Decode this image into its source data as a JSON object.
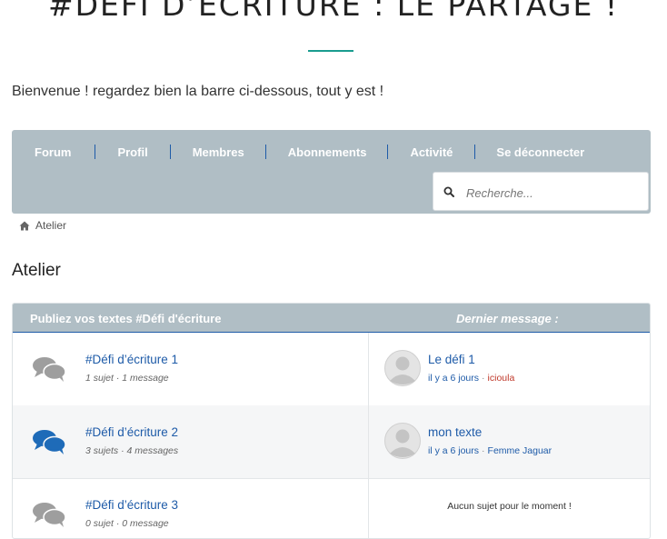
{
  "header": {
    "page_title": "#DÉFI D’ÉCRITURE : LE PARTAGE !",
    "welcome": "Bienvenue ! regardez bien la barre ci-dessous, tout y est !"
  },
  "nav": {
    "items": [
      "Forum",
      "Profil",
      "Membres",
      "Abonnements",
      "Activité",
      "Se déconnecter"
    ],
    "search_placeholder": "Recherche..."
  },
  "breadcrumb": {
    "label": "Atelier"
  },
  "section": {
    "title": "Atelier"
  },
  "forum_table": {
    "header_left": "Publiez vos textes #Défi d'écriture",
    "header_right": "Dernier message :",
    "rows": [
      {
        "name": "#Défi d’écriture 1",
        "stats": "1 sujet · 1 message",
        "last_title": "Le défi 1",
        "last_time": "il y a 6 jours",
        "last_author": "icioula",
        "author_color": "#c0392b",
        "icon_color": "#9e9e9e"
      },
      {
        "name": "#Défi d’écriture 2",
        "stats": "3 sujets · 4 messages",
        "last_title": "mon texte",
        "last_time": "il y a 6 jours",
        "last_author": "Femme Jaguar",
        "author_color": "#1e5ba8",
        "icon_color": "#1e6bb8"
      },
      {
        "name": "#Défi d’écriture 3",
        "stats": "0 sujet · 0 message",
        "empty_message": "Aucun sujet pour le moment !",
        "icon_color": "#9e9e9e"
      }
    ]
  },
  "colors": {
    "accent_teal": "#1a9c8f",
    "nav_bg": "#b0bec5",
    "link_blue": "#1e5ba8"
  }
}
